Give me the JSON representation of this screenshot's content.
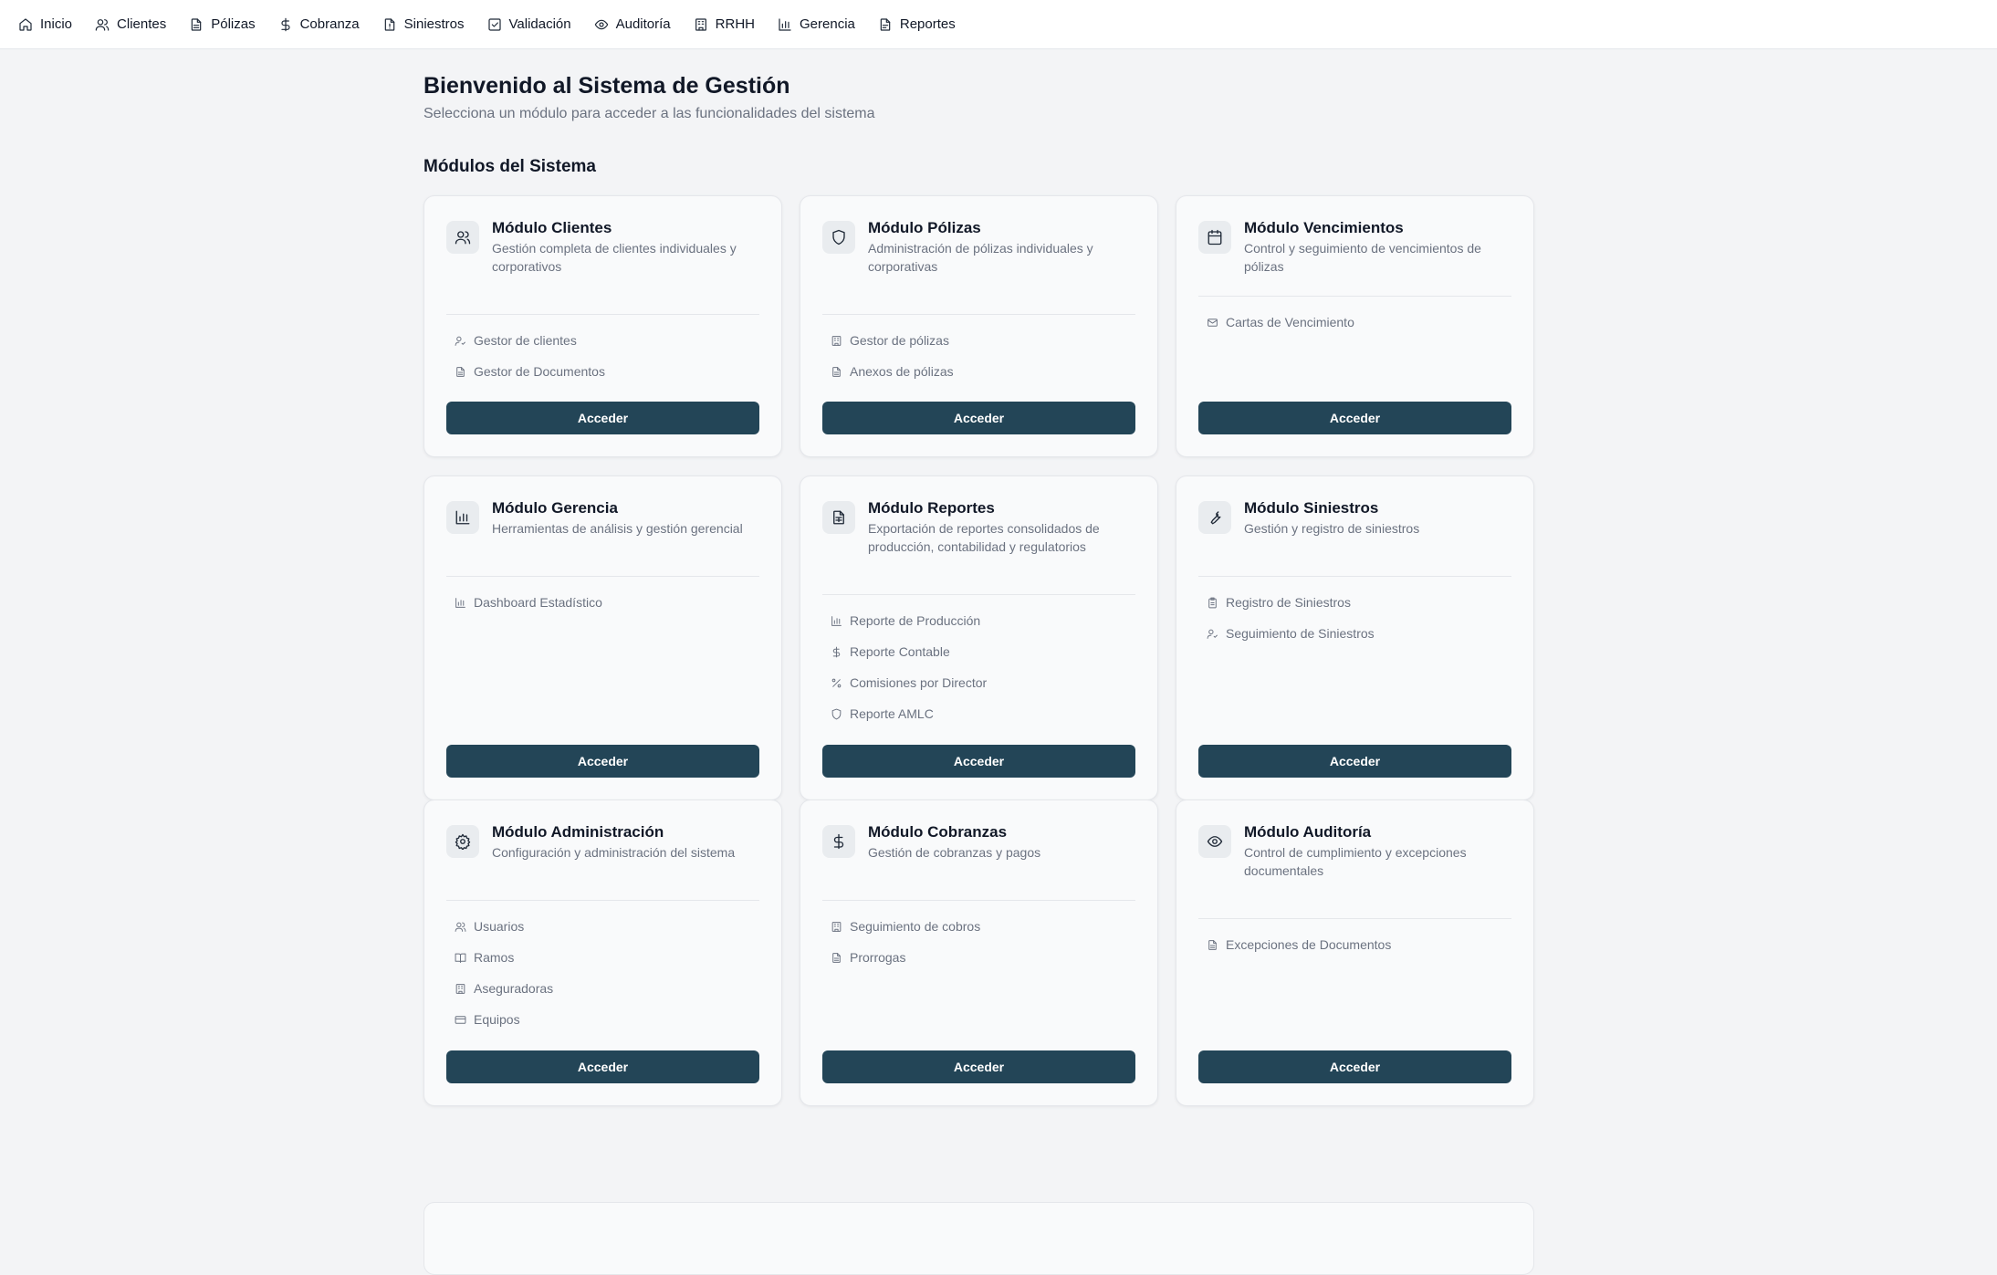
{
  "nav": [
    {
      "label": "Inicio",
      "icon": "home-icon"
    },
    {
      "label": "Clientes",
      "icon": "users-icon"
    },
    {
      "label": "Pólizas",
      "icon": "file-icon"
    },
    {
      "label": "Cobranza",
      "icon": "dollar-icon"
    },
    {
      "label": "Siniestros",
      "icon": "alert-file-icon"
    },
    {
      "label": "Validación",
      "icon": "check-square-icon"
    },
    {
      "label": "Auditoría",
      "icon": "eye-icon"
    },
    {
      "label": "RRHH",
      "icon": "building-icon"
    },
    {
      "label": "Gerencia",
      "icon": "bar-chart-icon"
    },
    {
      "label": "Reportes",
      "icon": "file-text-icon"
    }
  ],
  "header": {
    "title": "Bienvenido al Sistema de Gestión",
    "subtitle": "Selecciona un módulo para acceder a las funcionalidades del sistema",
    "section": "Módulos del Sistema"
  },
  "button_label": "Acceder",
  "cards": [
    {
      "title": "Módulo Clientes",
      "desc": "Gestión completa de clientes individuales y corporativos",
      "icon": "users-icon",
      "links": [
        {
          "label": "Gestor de clientes",
          "icon": "user-check-icon"
        },
        {
          "label": "Gestor de Documentos",
          "icon": "file-icon"
        }
      ]
    },
    {
      "title": "Módulo Pólizas",
      "desc": "Administración de pólizas individuales y corporativas",
      "icon": "shield-icon",
      "links": [
        {
          "label": "Gestor de pólizas",
          "icon": "building-icon"
        },
        {
          "label": "Anexos de pólizas",
          "icon": "file-icon"
        }
      ]
    },
    {
      "title": "Módulo Vencimientos",
      "desc": "Control y seguimiento de vencimientos de pólizas",
      "icon": "calendar-icon",
      "links": [
        {
          "label": "Cartas de Vencimiento",
          "icon": "mail-icon"
        }
      ]
    },
    {
      "title": "Módulo Gerencia",
      "desc": "Herramientas de análisis y gestión gerencial",
      "icon": "bar-chart-icon",
      "links": [
        {
          "label": "Dashboard Estadístico",
          "icon": "bar-chart-icon"
        }
      ]
    },
    {
      "title": "Módulo Reportes",
      "desc": "Exportación de reportes consolidados de producción, contabilidad y regulatorios",
      "icon": "file-spreadsheet-icon",
      "links": [
        {
          "label": "Reporte de Producción",
          "icon": "bar-chart-icon"
        },
        {
          "label": "Reporte Contable",
          "icon": "dollar-icon"
        },
        {
          "label": "Comisiones por Director",
          "icon": "percent-icon"
        },
        {
          "label": "Reporte AMLC",
          "icon": "shield-icon"
        }
      ]
    },
    {
      "title": "Módulo Siniestros",
      "desc": "Gestión y registro de siniestros",
      "icon": "wrench-icon",
      "links": [
        {
          "label": "Registro de Siniestros",
          "icon": "clipboard-icon"
        },
        {
          "label": "Seguimiento de Siniestros",
          "icon": "user-check-icon"
        }
      ]
    },
    {
      "title": "Módulo Administración",
      "desc": "Configuración y administración del sistema",
      "icon": "gear-icon",
      "links": [
        {
          "label": "Usuarios",
          "icon": "users-icon"
        },
        {
          "label": "Ramos",
          "icon": "book-icon"
        },
        {
          "label": "Aseguradoras",
          "icon": "building-icon"
        },
        {
          "label": "Equipos",
          "icon": "card-icon"
        }
      ]
    },
    {
      "title": "Módulo Cobranzas",
      "desc": "Gestión de cobranzas y pagos",
      "icon": "dollar-icon",
      "links": [
        {
          "label": "Seguimiento de cobros",
          "icon": "building-icon"
        },
        {
          "label": "Prorrogas",
          "icon": "file-icon"
        }
      ]
    },
    {
      "title": "Módulo Auditoría",
      "desc": "Control de cumplimiento y excepciones documentales",
      "icon": "eye-icon",
      "links": [
        {
          "label": "Excepciones de Documentos",
          "icon": "file-icon"
        }
      ]
    }
  ]
}
